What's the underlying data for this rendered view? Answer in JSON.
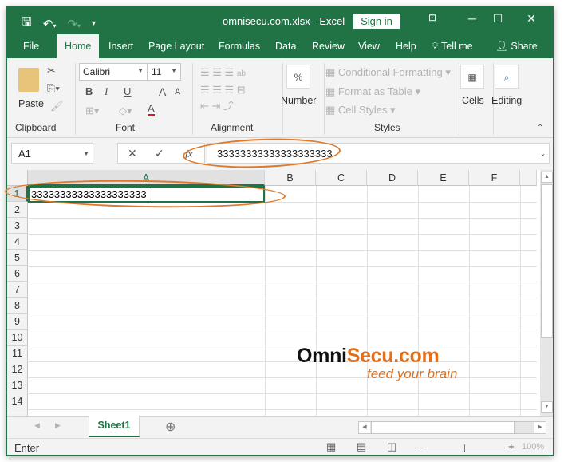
{
  "titlebar": {
    "title": "omnisecu.com.xlsx  -  Excel",
    "signin_label": "Sign in",
    "qat": {
      "save_icon": "save-icon",
      "undo_icon": "undo-icon",
      "redo_icon": "redo-icon",
      "customize_icon": "customize-qat-icon"
    }
  },
  "tabs": [
    {
      "label": "File"
    },
    {
      "label": "Home",
      "active": true
    },
    {
      "label": "Insert"
    },
    {
      "label": "Page Layout"
    },
    {
      "label": "Formulas"
    },
    {
      "label": "Data"
    },
    {
      "label": "Review"
    },
    {
      "label": "View"
    },
    {
      "label": "Help"
    },
    {
      "label": "Tell me"
    },
    {
      "label": "Share"
    }
  ],
  "ribbon": {
    "clipboard": {
      "label": "Clipboard",
      "paste_label": "Paste"
    },
    "font": {
      "label": "Font",
      "font_name": "Calibri",
      "font_size": "11",
      "bold": "B",
      "italic": "I",
      "underline": "U",
      "grow": "A",
      "shrink": "A",
      "font_color": "A",
      "font_color_value": "#e81123"
    },
    "alignment": {
      "label": "Alignment"
    },
    "number": {
      "label": "Number",
      "icon_text": "%"
    },
    "styles": {
      "label": "Styles",
      "conditional_formatting": "Conditional Formatting",
      "format_as_table": "Format as Table",
      "cell_styles": "Cell Styles"
    },
    "cells": {
      "label": "Cells"
    },
    "editing": {
      "label": "Editing"
    }
  },
  "formula_bar": {
    "name_box": "A1",
    "cancel": "✕",
    "enter": "✓",
    "fx": "fx",
    "value": "33333333333333333333"
  },
  "grid": {
    "columns": [
      "A",
      "B",
      "C",
      "D",
      "E",
      "F"
    ],
    "rows": [
      "1",
      "2",
      "3",
      "4",
      "5",
      "6",
      "7",
      "8",
      "9",
      "10",
      "11",
      "12",
      "13",
      "14"
    ],
    "cell_A1": "33333333333333333333"
  },
  "sheets": {
    "tabs": [
      {
        "label": "Sheet1",
        "active": true
      }
    ],
    "add_icon": "⊕"
  },
  "status": {
    "mode": "Enter",
    "zoom": "100%"
  },
  "watermark": {
    "brand_black": "Omni",
    "brand_orange": "Secu.com",
    "tagline": "feed your brain",
    "orange": "#e0701e"
  }
}
